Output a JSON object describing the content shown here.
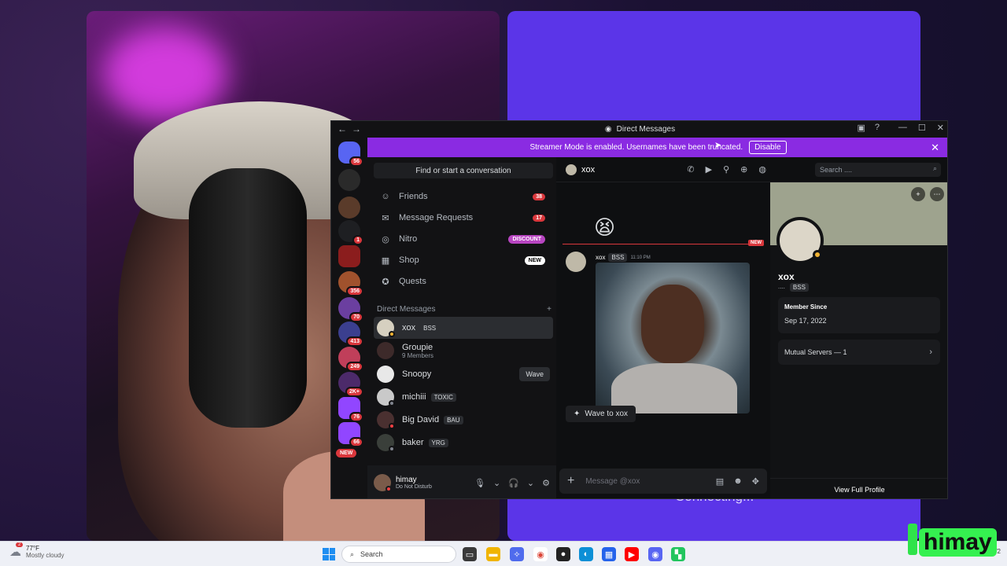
{
  "window": {
    "title": "Direct Messages",
    "streamer_banner": "Streamer Mode is enabled. Usernames have been truncated.",
    "disable_label": "Disable"
  },
  "servers": {
    "badges": [
      "56",
      "1",
      "356",
      "70",
      "413",
      "249",
      "2K+",
      "76",
      "66"
    ],
    "new_label": "NEW"
  },
  "sidebar": {
    "find_placeholder": "Find or start a conversation",
    "nav": [
      {
        "label": "Friends",
        "count": "38",
        "icon": "friends-icon"
      },
      {
        "label": "Message Requests",
        "count": "17",
        "icon": "mail-icon"
      },
      {
        "label": "Nitro",
        "pill": "DISCOUNT",
        "icon": "nitro-icon"
      },
      {
        "label": "Shop",
        "pill": "NEW",
        "icon": "shop-icon"
      },
      {
        "label": "Quests",
        "icon": "quests-icon"
      }
    ],
    "dm_header": "Direct Messages",
    "dms": [
      {
        "name": "xox",
        "tag": "BSS",
        "status": "#f0b232"
      },
      {
        "name": "Groupie",
        "sub": "9 Members"
      },
      {
        "name": "Snoopy",
        "action": "Wave"
      },
      {
        "name": "michiii",
        "tag": "TOXIC",
        "status": "#80848e"
      },
      {
        "name": "Big David",
        "tag": "BAU",
        "status": "#f23f43"
      },
      {
        "name": "baker",
        "tag": "YRG",
        "status": "#80848e"
      }
    ]
  },
  "user": {
    "name": "himay",
    "status": "Do Not Disturb"
  },
  "chat": {
    "channel": "xox",
    "search_placeholder": "Search ....",
    "new_label": "NEW",
    "message": {
      "author": "xox",
      "tag": "BSS",
      "time": "11:10 PM"
    },
    "wave_label": "Wave to xox",
    "composer_placeholder": "Message @xox"
  },
  "profile": {
    "name": "xox",
    "tags": [
      "....",
      "BSS"
    ],
    "member_since_label": "Member Since",
    "member_since": "Sep 17, 2022",
    "mutual_servers": "Mutual Servers — 1",
    "view_full": "View Full Profile"
  },
  "stream": {
    "caption": "Connecting..."
  },
  "taskbar": {
    "weather_temp": "77°F",
    "weather_cond": "Mostly cloudy",
    "weather_badge": "2",
    "search_placeholder": "Search",
    "tray_date": "5/31/2"
  },
  "overlay": {
    "logo_text": "himay"
  }
}
